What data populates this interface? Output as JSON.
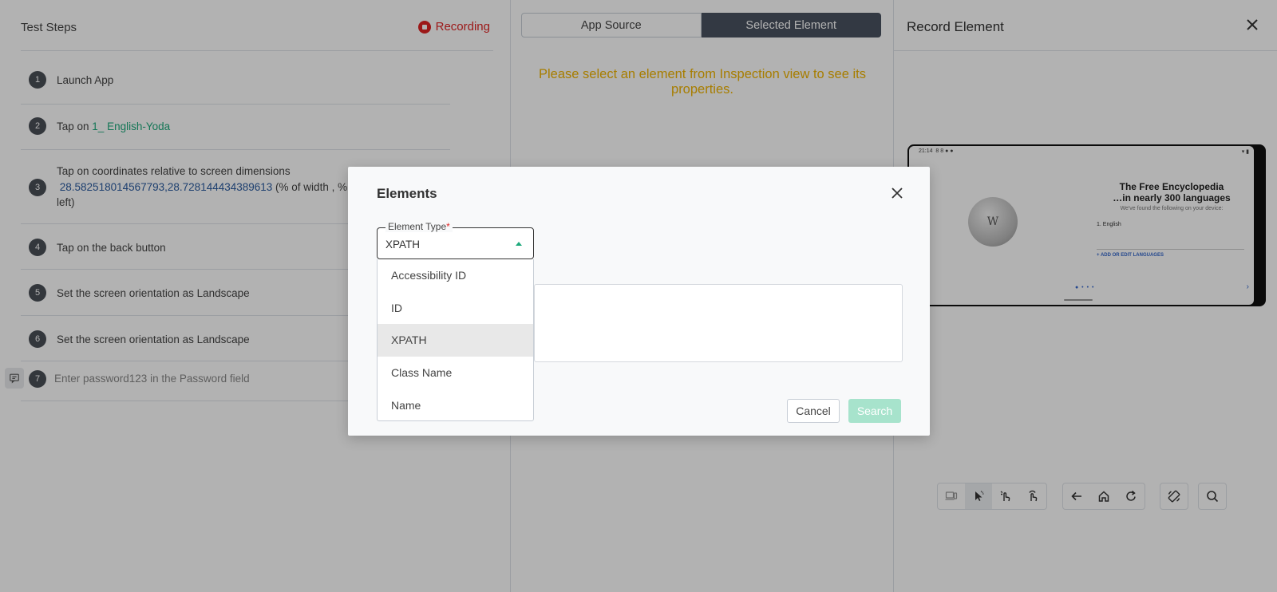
{
  "left_panel": {
    "title": "Test Steps",
    "recording_label": "Recording",
    "steps": [
      {
        "num": "1",
        "text": "Launch App"
      },
      {
        "num": "2",
        "prefix": "Tap on ",
        "highlight": "1_ English-Yoda"
      },
      {
        "num": "3",
        "line1": "Tap on coordinates relative to screen dimensions",
        "coords": "28.582518014567793,28.728144434389613",
        "line2_rest": " (% of width , % of h",
        "line3": "left)"
      },
      {
        "num": "4",
        "text": "Tap on the back button"
      },
      {
        "num": "5",
        "text": "Set the screen orientation as Landscape"
      },
      {
        "num": "6",
        "text": "Set the screen orientation as Landscape"
      },
      {
        "num": "7",
        "text": "Enter password123 in the Password field"
      }
    ]
  },
  "middle_panel": {
    "tabs": [
      "App Source",
      "Selected Element"
    ],
    "active_tab": "Selected Element",
    "message": "Please select an element from Inspection view to see its properties."
  },
  "right_panel": {
    "title": "Record Element",
    "device_screen": {
      "time": "21:14",
      "status_icons": "8 8 ● ●",
      "status_right": "▾ ▮",
      "globe_glyph": "W",
      "title": "The Free Encyclopedia\n…in nearly 300 languages",
      "subtitle": "We've found the following on your device:",
      "language_item": "1.  English",
      "add_languages": "+   ADD OR EDIT LANGUAGES",
      "dots": "● • • •",
      "next": "›"
    },
    "toolbar_icons": [
      "device-icon",
      "select-pointer-icon",
      "tap-gesture-icon",
      "swipe-gesture-icon",
      "back-arrow-icon",
      "home-icon",
      "refresh-icon",
      "rotate-icon",
      "search-icon"
    ]
  },
  "modal": {
    "title": "Elements",
    "field_label": "Element Type",
    "required_mark": "*",
    "selected_value": "XPATH",
    "options": [
      "Accessibility ID",
      "ID",
      "XPATH",
      "Class Name",
      "Name"
    ],
    "cancel_label": "Cancel",
    "search_label": "Search"
  },
  "colors": {
    "accent_green": "#1ea97c",
    "recording_red": "#e02424",
    "message_yellow": "#f0b400",
    "active_tab": "#4a5260"
  }
}
